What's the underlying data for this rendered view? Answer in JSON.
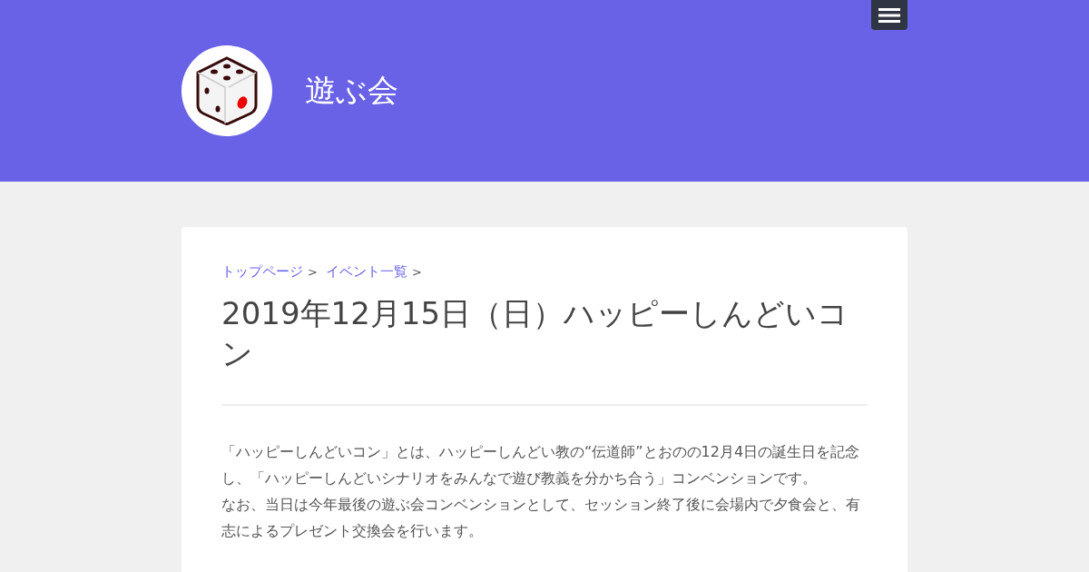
{
  "header": {
    "site_title": "遊ぶ会"
  },
  "breadcrumb": [
    {
      "label": "トップページ",
      "separator": ">"
    },
    {
      "label": "イベント一覧",
      "separator": ">"
    }
  ],
  "article": {
    "title": "2019年12月15日（日）ハッピーしんどいコン",
    "paragraphs": [
      "「ハッピーしんどいコン」とは、ハッピーしんどい教の“伝道師”とおのの12月4日の誕生日を記念し、「ハッピーしんどいシナリオをみんなで遊び教義を分かち合う」コンベンションです。",
      "なお、当日は今年最後の遊ぶ会コンベンションとして、セッション終了後に会場内で夕食会と、有志によるプレゼント交換会を行います。"
    ]
  }
}
